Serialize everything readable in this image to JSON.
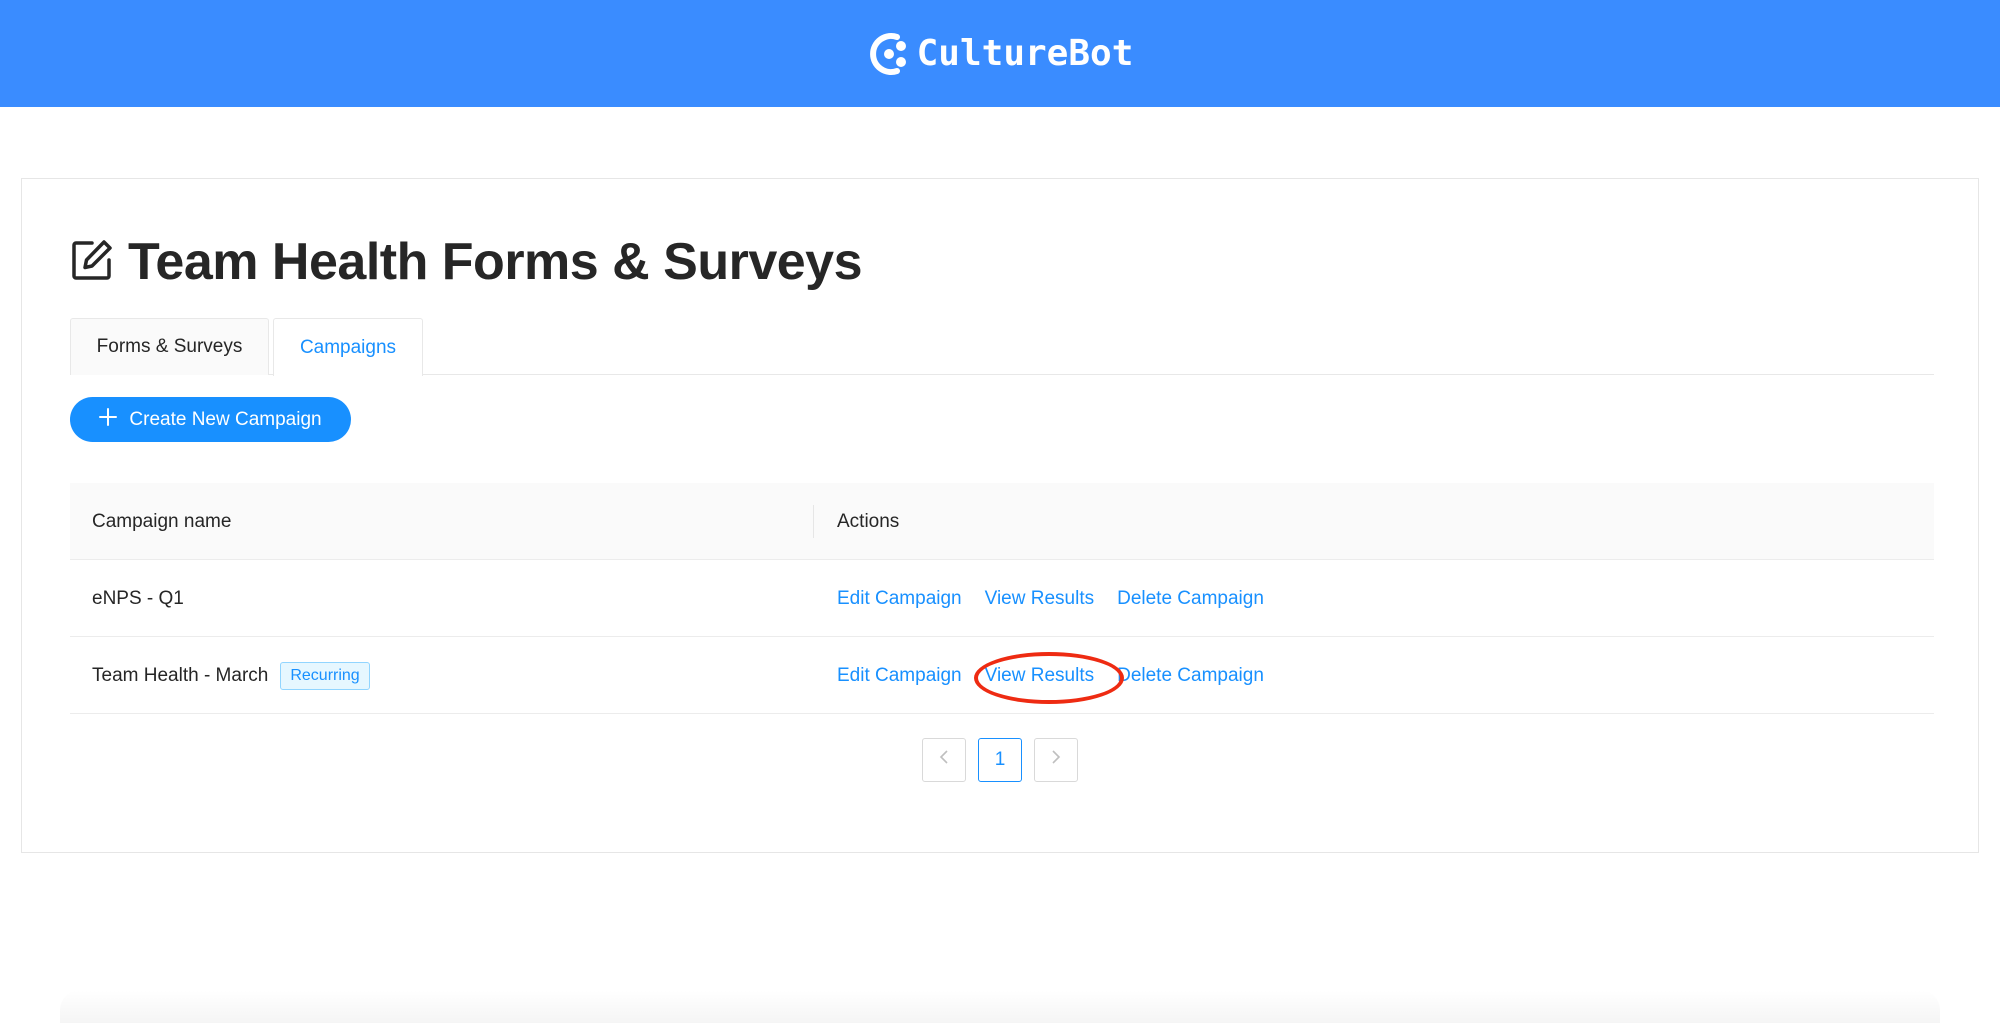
{
  "header": {
    "brand_name": "CultureBot",
    "logo_icon": "culturebot-logo",
    "background_color": "#3a8cff"
  },
  "page": {
    "title": "Team Health Forms & Surveys",
    "title_icon": "edit-icon"
  },
  "tabs": [
    {
      "label": "Forms & Surveys",
      "active": false
    },
    {
      "label": "Campaigns",
      "active": true
    }
  ],
  "create_button": {
    "label": "Create New Campaign",
    "icon": "plus-icon"
  },
  "table": {
    "columns": [
      "Campaign name",
      "Actions"
    ],
    "rows": [
      {
        "name": "eNPS - Q1",
        "tag": null,
        "actions": [
          "Edit Campaign",
          "View Results",
          "Delete Campaign"
        ]
      },
      {
        "name": "Team Health - March",
        "tag": "Recurring",
        "actions": [
          "Edit Campaign",
          "View Results",
          "Delete Campaign"
        ]
      }
    ]
  },
  "pagination": {
    "prev_icon": "chevron-left-icon",
    "current_page": "1",
    "next_icon": "chevron-right-icon"
  },
  "annotation": {
    "highlighted_action": "View Results",
    "highlight_color": "#ee2b12"
  },
  "colors": {
    "accent": "#1890ff"
  }
}
